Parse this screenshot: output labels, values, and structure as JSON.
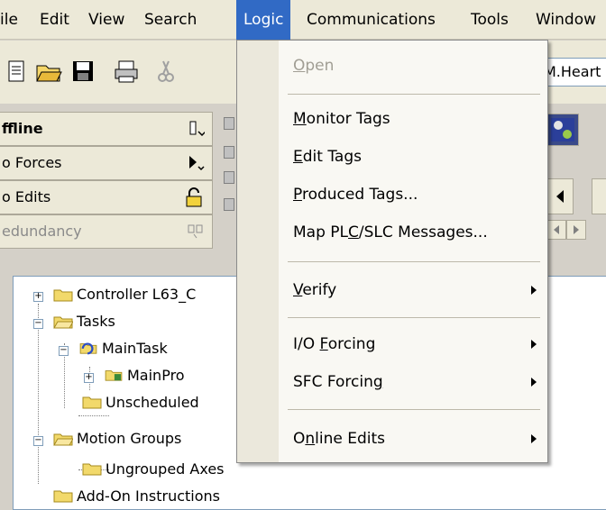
{
  "menubar": {
    "items": [
      {
        "label": "ile"
      },
      {
        "label": "Edit"
      },
      {
        "label": "View"
      },
      {
        "label": "Search"
      },
      {
        "label": "Logic"
      },
      {
        "label": "Communications"
      },
      {
        "label": "Tools"
      },
      {
        "label": "Window"
      }
    ]
  },
  "toolbar": {
    "path_value": "M.Heart"
  },
  "status": {
    "mode": "ffline",
    "forces": "o Forces",
    "edits": "o Edits",
    "redundancy": "edundancy"
  },
  "tree": {
    "nodes": [
      {
        "label": "Controller L63_C"
      },
      {
        "label": "Tasks"
      },
      {
        "label": "MainTask"
      },
      {
        "label": "MainPro"
      },
      {
        "label": "Unscheduled"
      },
      {
        "label": "Motion Groups"
      },
      {
        "label": "Ungrouped Axes"
      },
      {
        "label": "Add-On Instructions"
      }
    ]
  },
  "logic_menu": {
    "open": {
      "pre": "",
      "acc": "O",
      "post": "pen"
    },
    "monitor_tags": {
      "pre": "",
      "acc": "M",
      "post": "onitor Tags"
    },
    "edit_tags": {
      "pre": "",
      "acc": "E",
      "post": "dit Tags"
    },
    "produced_tags": {
      "pre": "",
      "acc": "P",
      "post": "roduced Tags..."
    },
    "map_messages": {
      "pre": "Map PL",
      "acc": "C",
      "post": "/SLC Messages..."
    },
    "verify": {
      "pre": "",
      "acc": "V",
      "post": "erify"
    },
    "io_forcing": {
      "pre": "I/O ",
      "acc": "F",
      "post": "orcing"
    },
    "sfc_forcing": {
      "pre": "SFC Forcin",
      "acc": "g",
      "post": ""
    },
    "online_edits": {
      "pre": "O",
      "acc": "n",
      "post": "line Edits"
    }
  },
  "colors": {
    "menu_highlight": "#316ac5",
    "disabled_text": "#a19e94"
  }
}
